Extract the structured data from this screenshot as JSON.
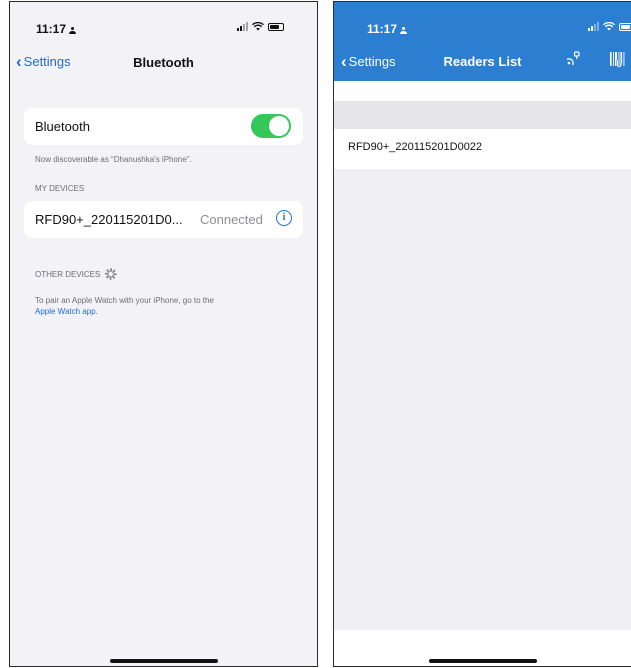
{
  "left_phone": {
    "status_time": "11:17",
    "nav": {
      "back_label": "Settings",
      "title": "Bluetooth"
    },
    "bluetooth_label": "Bluetooth",
    "bluetooth_on": true,
    "discoverable_text": "Now discoverable as “Dhanushka's iPhone”.",
    "my_devices_header": "MY DEVICES",
    "device": {
      "name": "RFD90+_220115201D0...",
      "status": "Connected",
      "info_glyph": "i"
    },
    "other_devices_header": "OTHER DEVICES",
    "pair_text": "To pair an Apple Watch with your iPhone, go to the",
    "pair_link": "Apple Watch app."
  },
  "right_phone": {
    "status_time": "11:17",
    "nav": {
      "back_label": "Settings",
      "title": "Readers List"
    },
    "header_icons": [
      "connect-rfid-icon",
      "barcode-icon"
    ],
    "readers": [
      {
        "name": "RFD90+_220115201D0022"
      }
    ]
  },
  "colors": {
    "ios_blue": "#1a6fd6",
    "toggle_green": "#34c759",
    "app_header": "#2c7ed0"
  }
}
